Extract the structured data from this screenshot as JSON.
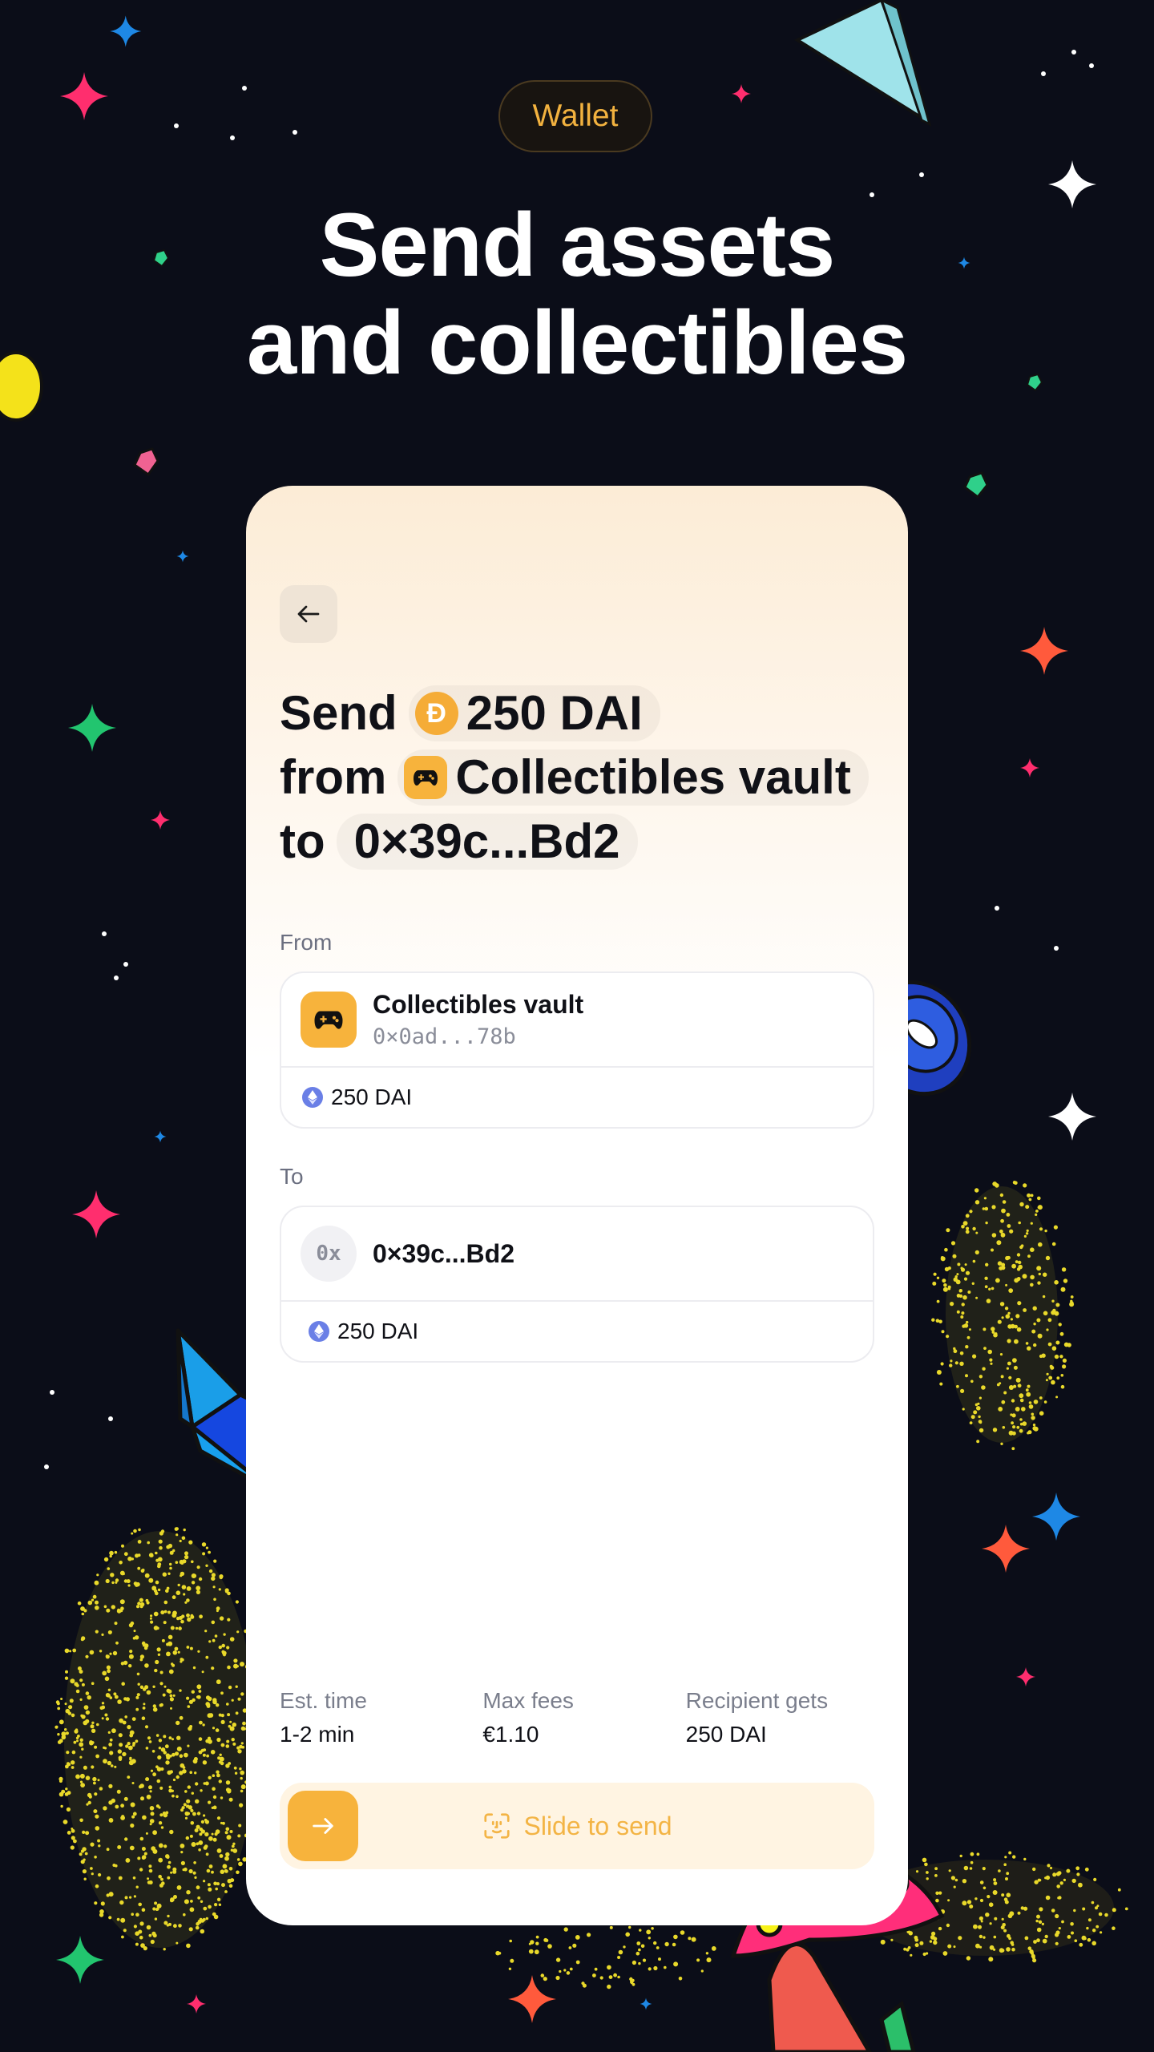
{
  "badge": "Wallet",
  "headline": {
    "line1": "Send assets",
    "line2": "and collectibles"
  },
  "card": {
    "title": {
      "send_word": "Send",
      "amount": "250 DAI",
      "from_word": "from",
      "source_account": "Collectibles vault",
      "to_word": "to",
      "recipient": "0×39c...Bd2"
    },
    "from_section": {
      "label": "From",
      "account_name": "Collectibles vault",
      "account_address": "0×0ad...78b",
      "amount": "250 DAI"
    },
    "to_section": {
      "label": "To",
      "avatar_text": "0x",
      "address": "0×39c...Bd2",
      "amount": "250 DAI"
    },
    "stats": [
      {
        "label": "Est. time",
        "value": "1-2 min"
      },
      {
        "label": "Max fees",
        "value": "€1.10"
      },
      {
        "label": "Recipient gets",
        "value": "250 DAI"
      }
    ],
    "slider_label": "Slide to send"
  },
  "colors": {
    "background": "#0b0d18",
    "accent": "#f7b33c",
    "badge_text": "#f2b23f",
    "dai": "#f5ac37",
    "eth": "#6a7fe6"
  },
  "icons": {
    "back": "arrow-left-icon",
    "dai": "dai-coin-icon",
    "vault": "gamepad-icon",
    "network": "ethereum-icon",
    "slider_knob": "arrow-right-icon",
    "slider_text": "face-id-icon"
  }
}
